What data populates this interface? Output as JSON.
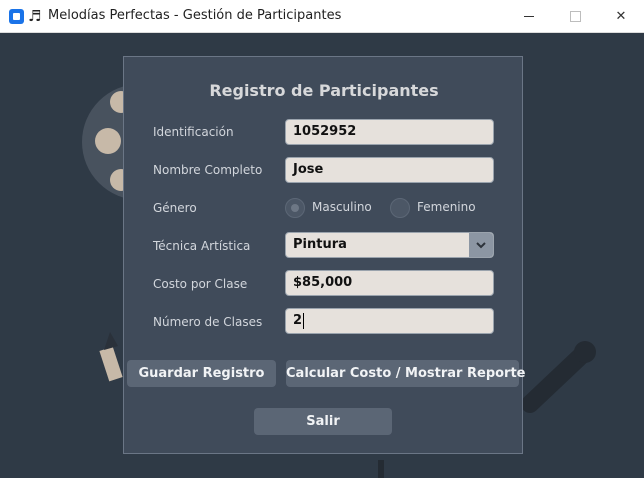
{
  "window": {
    "title": "Melodías Perfectas - Gestión de Participantes",
    "app_icon": "app-window-icon",
    "music_icon": "music-notes-icon"
  },
  "form": {
    "title": "Registro de Participantes",
    "fields": {
      "id_label": "Identificación",
      "id_value": "1052952",
      "name_label": "Nombre Completo",
      "name_value": "Jose",
      "gender_label": "Género",
      "gender_options": [
        "Masculino",
        "Femenino"
      ],
      "gender_selected": "Masculino",
      "technique_label": "Técnica Artística",
      "technique_value": "Pintura",
      "cost_label": "Costo por Clase",
      "cost_value": "$85,000",
      "classes_label": "Número de Clases",
      "classes_value": "2"
    },
    "buttons": {
      "save": "Guardar Registro",
      "calc": "Calcular Costo / Mostrar Reporte",
      "exit": "Salir"
    }
  },
  "colors": {
    "background": "#2f3a46",
    "panel": "#404b5a",
    "field": "#e6e1dc",
    "button": "#5b6675",
    "accent_icon": "#1a73e8"
  }
}
